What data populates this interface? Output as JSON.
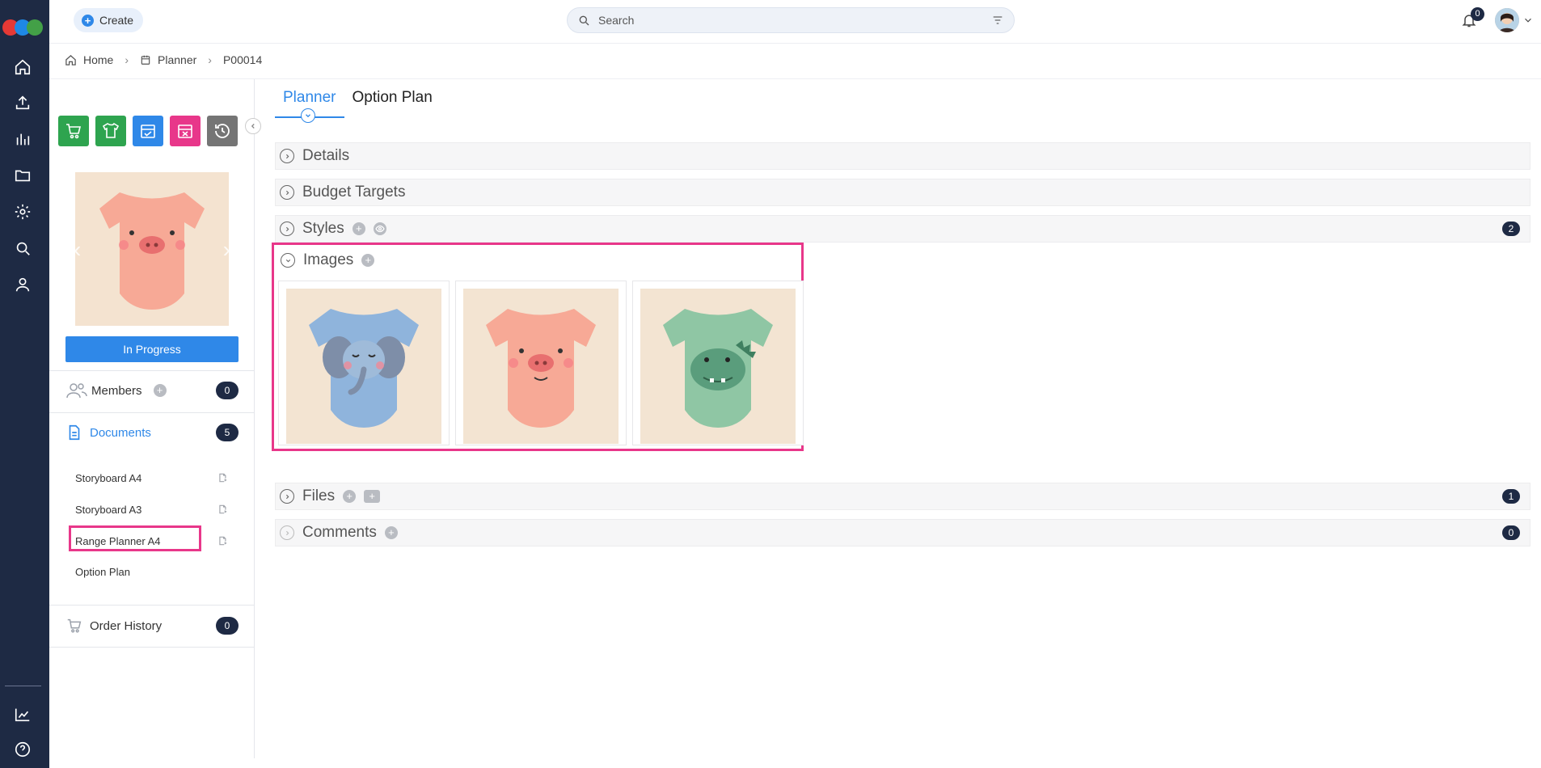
{
  "header": {
    "create_label": "Create",
    "search_placeholder": "Search",
    "notifications_count": "0"
  },
  "breadcrumb": {
    "home": "Home",
    "planner": "Planner",
    "current": "P00014"
  },
  "toolbar": {
    "buttons": [
      {
        "icon": "cart-add-icon",
        "color": "#2ea44f"
      },
      {
        "icon": "shirt-add-icon",
        "color": "#2ea44f"
      },
      {
        "icon": "calendar-check-icon",
        "color": "#2f88e8"
      },
      {
        "icon": "calendar-remove-icon",
        "color": "#e8378a"
      },
      {
        "icon": "history-icon",
        "color": "#757575"
      }
    ]
  },
  "product": {
    "status_label": "In Progress"
  },
  "left_panel": {
    "members_label": "Members",
    "members_count": "0",
    "documents_label": "Documents",
    "documents_count": "5",
    "documents": [
      {
        "label": "Storyboard A4"
      },
      {
        "label": "Storyboard A3"
      },
      {
        "label": "Range Planner A4"
      },
      {
        "label": "Option Plan"
      }
    ],
    "order_history_label": "Order History",
    "order_history_count": "0"
  },
  "tabs": [
    {
      "label": "Planner",
      "active": true
    },
    {
      "label": "Option Plan",
      "active": false
    }
  ],
  "sections": {
    "details": {
      "label": "Details"
    },
    "budget": {
      "label": "Budget Targets"
    },
    "styles": {
      "label": "Styles",
      "count": "2"
    },
    "images": {
      "label": "Images",
      "items": [
        "blue elephant onesie",
        "pink pig onesie",
        "green dinosaur onesie"
      ]
    },
    "files": {
      "label": "Files",
      "count": "1"
    },
    "comments": {
      "label": "Comments",
      "count": "0"
    }
  },
  "colors": {
    "accent": "#2f88e8",
    "rail": "#1e2a44",
    "highlight": "#e8378a"
  }
}
